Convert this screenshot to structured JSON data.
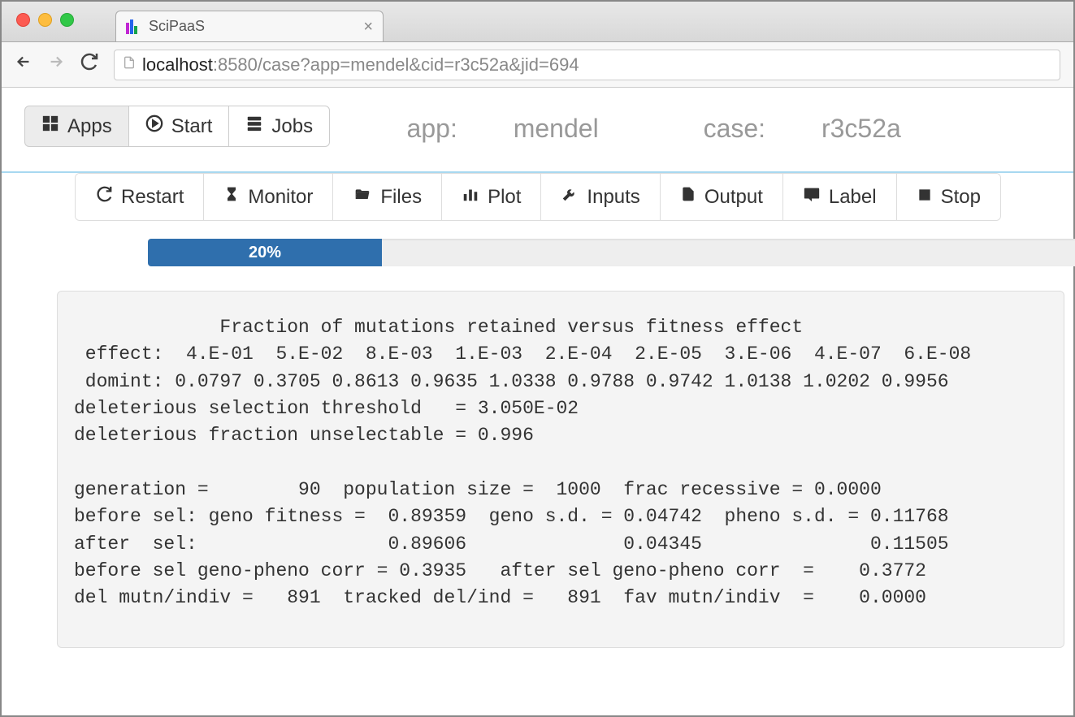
{
  "browser": {
    "tab_title": "SciPaaS",
    "url_host": "localhost",
    "url_path": ":8580/case?app=mendel&cid=r3c52a&jid=694"
  },
  "header": {
    "nav": {
      "apps": "Apps",
      "start": "Start",
      "jobs": "Jobs"
    },
    "info_app_label": "app: ",
    "info_app_value": "mendel",
    "info_case_label": "case: ",
    "info_case_value": "r3c52a"
  },
  "actions": {
    "restart": "Restart",
    "monitor": "Monitor",
    "files": "Files",
    "plot": "Plot",
    "inputs": "Inputs",
    "output": "Output",
    "label": "Label",
    "stop": "Stop"
  },
  "progress": {
    "percent": 20,
    "label": "20%"
  },
  "output_text": "             Fraction of mutations retained versus fitness effect\n effect:  4.E-01  5.E-02  8.E-03  1.E-03  2.E-04  2.E-05  3.E-06  4.E-07  6.E-08\n domint: 0.0797 0.3705 0.8613 0.9635 1.0338 0.9788 0.9742 1.0138 1.0202 0.9956\ndeleterious selection threshold   = 3.050E-02\ndeleterious fraction unselectable = 0.996\n\ngeneration =        90  population size =  1000  frac recessive = 0.0000\nbefore sel: geno fitness =  0.89359  geno s.d. = 0.04742  pheno s.d. = 0.11768\nafter  sel:                 0.89606              0.04345               0.11505\nbefore sel geno-pheno corr = 0.3935   after sel geno-pheno corr  =    0.3772\ndel mutn/indiv =   891  tracked del/ind =   891  fav mutn/indiv  =    0.0000"
}
